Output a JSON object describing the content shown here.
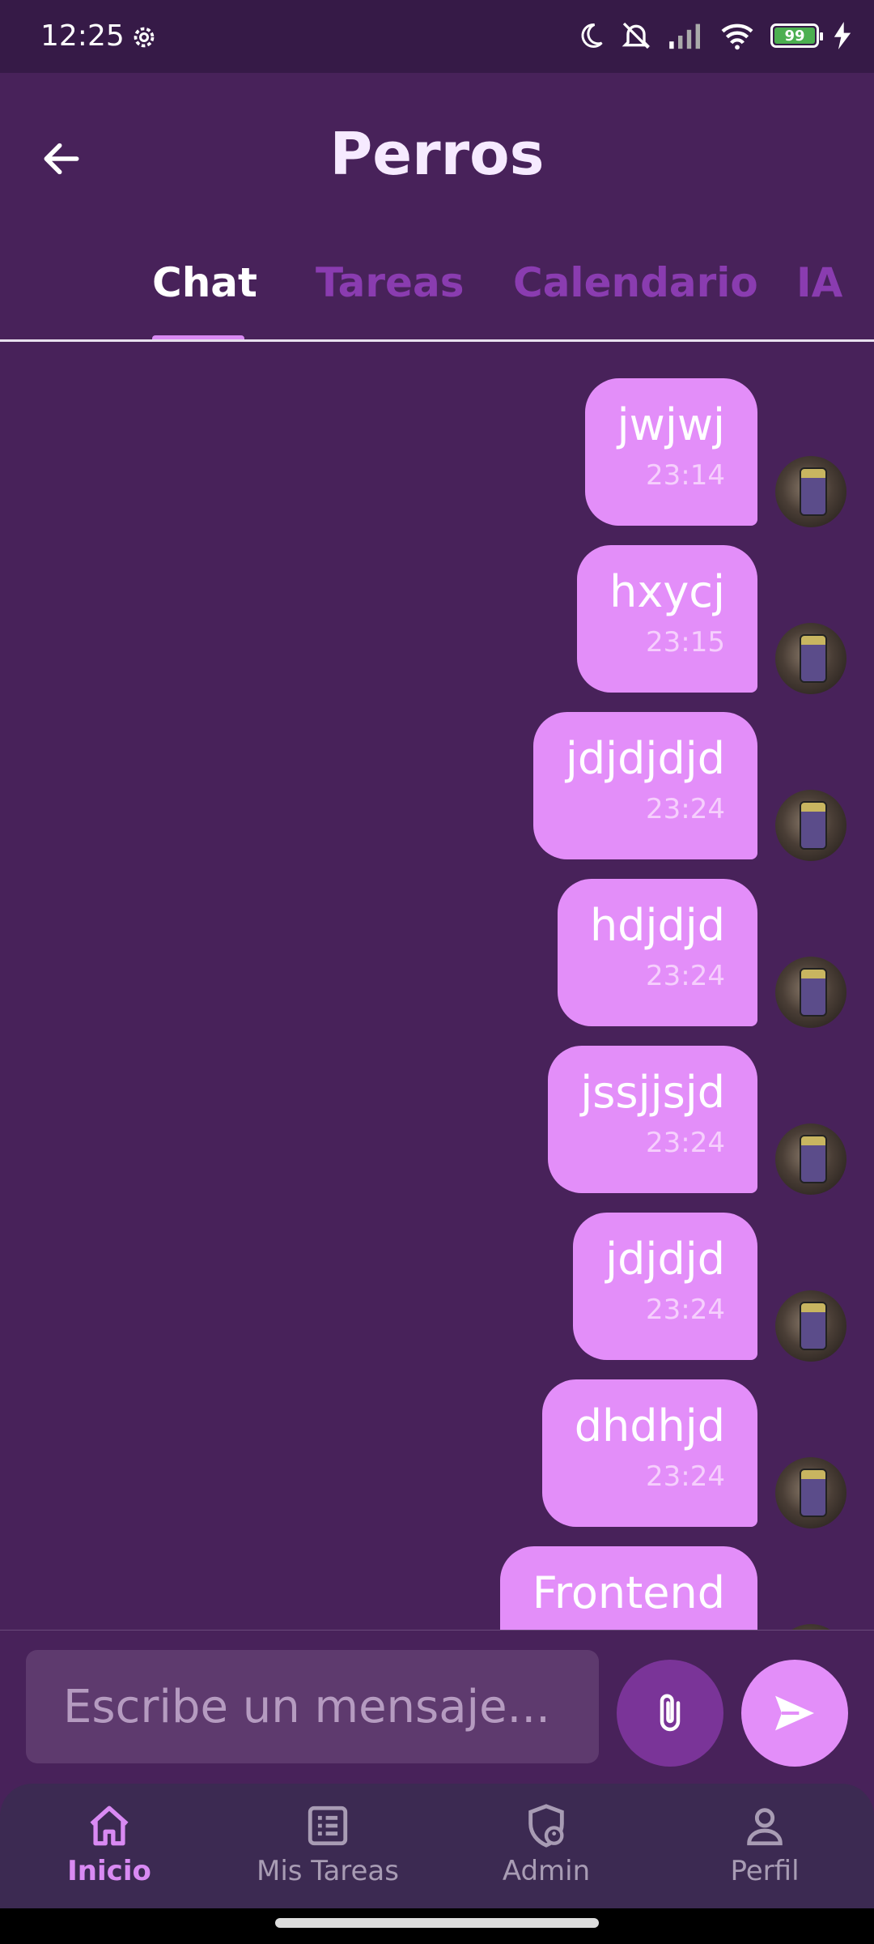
{
  "status_bar": {
    "time": "12:25",
    "battery": "99"
  },
  "header": {
    "title": "Perros"
  },
  "tabs": [
    {
      "label": "Chat",
      "active": true
    },
    {
      "label": "Tareas"
    },
    {
      "label": "Calendario"
    },
    {
      "label": "IA"
    }
  ],
  "messages": [
    {
      "text": "jwjwj",
      "time": "23:14"
    },
    {
      "text": "hxycj",
      "time": "23:15"
    },
    {
      "text": "jdjdjdjd",
      "time": "23:24"
    },
    {
      "text": "hdjdjd",
      "time": "23:24"
    },
    {
      "text": "jssjjsjd",
      "time": "23:24"
    },
    {
      "text": "jdjdjd",
      "time": "23:24"
    },
    {
      "text": "dhdhjd",
      "time": "23:24"
    },
    {
      "text": "Frontend",
      "time": ""
    }
  ],
  "composer": {
    "placeholder": "Escribe un mensaje..."
  },
  "bottom_nav": [
    {
      "label": "Inicio",
      "icon": "home-icon",
      "active": true
    },
    {
      "label": "Mis Tareas",
      "icon": "list-icon"
    },
    {
      "label": "Admin",
      "icon": "admin-shield-icon"
    },
    {
      "label": "Perfil",
      "icon": "person-icon"
    }
  ],
  "colors": {
    "background": "#48225a",
    "bubble": "#e38ef9",
    "accent": "#d98af3",
    "nav": "#3c2a52"
  }
}
